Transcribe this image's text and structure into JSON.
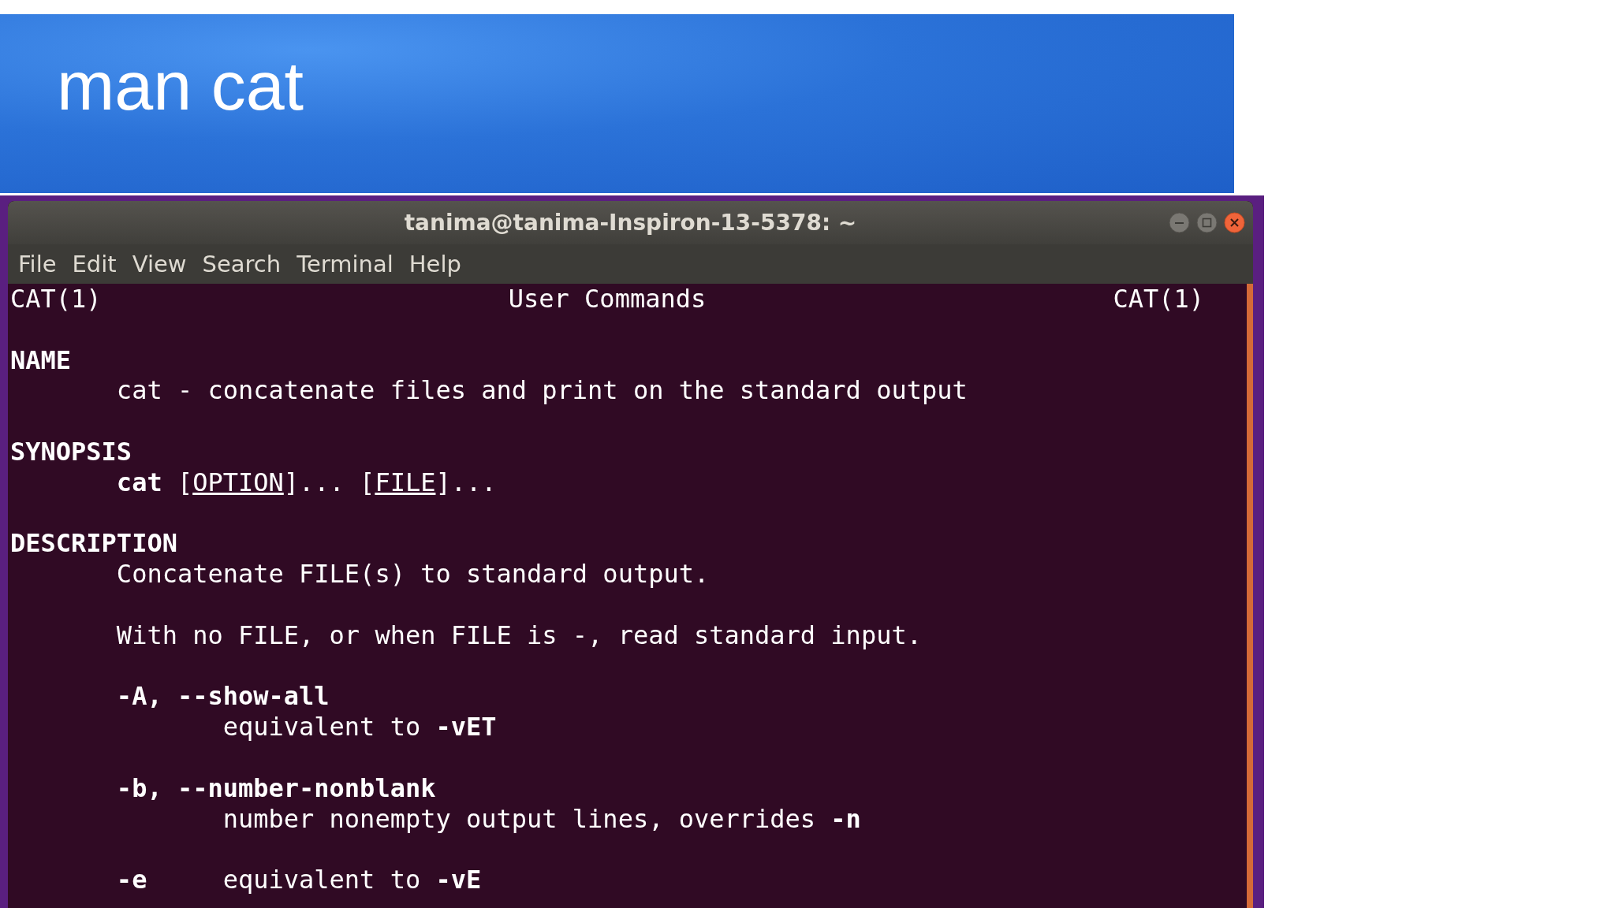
{
  "slide_title": "man cat",
  "terminal": {
    "title": "tanima@tanima-Inspiron-13-5378: ~",
    "menu": [
      "File",
      "Edit",
      "View",
      "Search",
      "Terminal",
      "Help"
    ],
    "header": {
      "left": "CAT(1)",
      "center": "User Commands",
      "right": "CAT(1)"
    },
    "sections": [
      {
        "heading": "NAME",
        "body": [
          {
            "kind": "text",
            "segments": [
              {
                "kind": "plain",
                "text": "cat - concatenate files and print on the standard output"
              }
            ]
          }
        ]
      },
      {
        "heading": "SYNOPSIS",
        "body": [
          {
            "kind": "text",
            "segments": [
              {
                "kind": "bold",
                "text": "cat"
              },
              {
                "kind": "plain",
                "text": " ["
              },
              {
                "kind": "underline",
                "text": "OPTION"
              },
              {
                "kind": "plain",
                "text": "]... ["
              },
              {
                "kind": "underline",
                "text": "FILE"
              },
              {
                "kind": "plain",
                "text": "]..."
              }
            ]
          }
        ]
      },
      {
        "heading": "DESCRIPTION",
        "body": [
          {
            "kind": "text",
            "segments": [
              {
                "kind": "plain",
                "text": "Concatenate FILE(s) to standard output."
              }
            ]
          },
          {
            "kind": "text",
            "segments": [
              {
                "kind": "plain",
                "text": "With no FILE, or when FILE is -, read standard input."
              }
            ]
          },
          {
            "kind": "option",
            "term": "-A, --show-all",
            "segments": [
              {
                "kind": "plain",
                "text": "equivalent to "
              },
              {
                "kind": "bold",
                "text": "-vET"
              }
            ]
          },
          {
            "kind": "option",
            "term": "-b, --number-nonblank",
            "segments": [
              {
                "kind": "plain",
                "text": "number nonempty output lines, overrides "
              },
              {
                "kind": "bold",
                "text": "-n"
              }
            ]
          },
          {
            "kind": "option_inline",
            "term": "-e",
            "segments": [
              {
                "kind": "plain",
                "text": "equivalent to "
              },
              {
                "kind": "bold",
                "text": "-vE"
              }
            ]
          }
        ]
      }
    ]
  }
}
